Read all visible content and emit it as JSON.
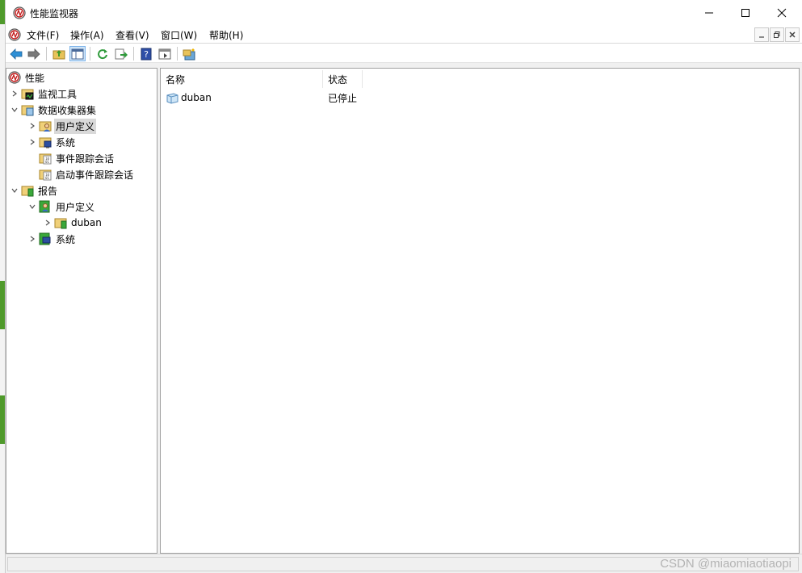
{
  "window": {
    "title": "性能监视器"
  },
  "menu": {
    "items": [
      "文件(F)",
      "操作(A)",
      "查看(V)",
      "窗口(W)",
      "帮助(H)"
    ]
  },
  "toolbar": {
    "buttons": [
      "back-icon",
      "forward-icon",
      "up-folder-icon",
      "show-hide-tree-icon",
      "refresh-icon",
      "export-list-icon",
      "help-icon",
      "properties-icon",
      "new-data-collector-icon"
    ]
  },
  "tree": {
    "items": [
      {
        "label": "性能",
        "icon": "performance-icon",
        "expander": "none"
      },
      {
        "label": "监视工具",
        "icon": "monitor-folder-icon",
        "expander": "collapsed"
      },
      {
        "label": "数据收集器集",
        "icon": "collector-folder-icon",
        "expander": "expanded"
      },
      {
        "label": "用户定义",
        "icon": "user-folder-icon",
        "expander": "collapsed",
        "selected": true
      },
      {
        "label": "系统",
        "icon": "system-folder-icon",
        "expander": "collapsed"
      },
      {
        "label": "事件跟踪会话",
        "icon": "trace-folder-icon",
        "expander": "none"
      },
      {
        "label": "启动事件跟踪会话",
        "icon": "startup-trace-folder-icon",
        "expander": "none"
      },
      {
        "label": "报告",
        "icon": "report-folder-icon",
        "expander": "expanded"
      },
      {
        "label": "用户定义",
        "icon": "user-report-icon",
        "expander": "expanded"
      },
      {
        "label": "duban",
        "icon": "report-item-icon",
        "expander": "collapsed"
      },
      {
        "label": "系统",
        "icon": "system-report-icon",
        "expander": "collapsed"
      }
    ]
  },
  "list": {
    "columns": [
      "名称",
      "状态"
    ],
    "rows": [
      {
        "name": "duban",
        "status": "已停止"
      }
    ]
  },
  "watermark": "CSDN @miaomiaotiaopi",
  "colors": {
    "selection": "#d9d9d9",
    "toolbar_pressed": "#cfe4f7",
    "pane_border": "#a0a0a0"
  }
}
